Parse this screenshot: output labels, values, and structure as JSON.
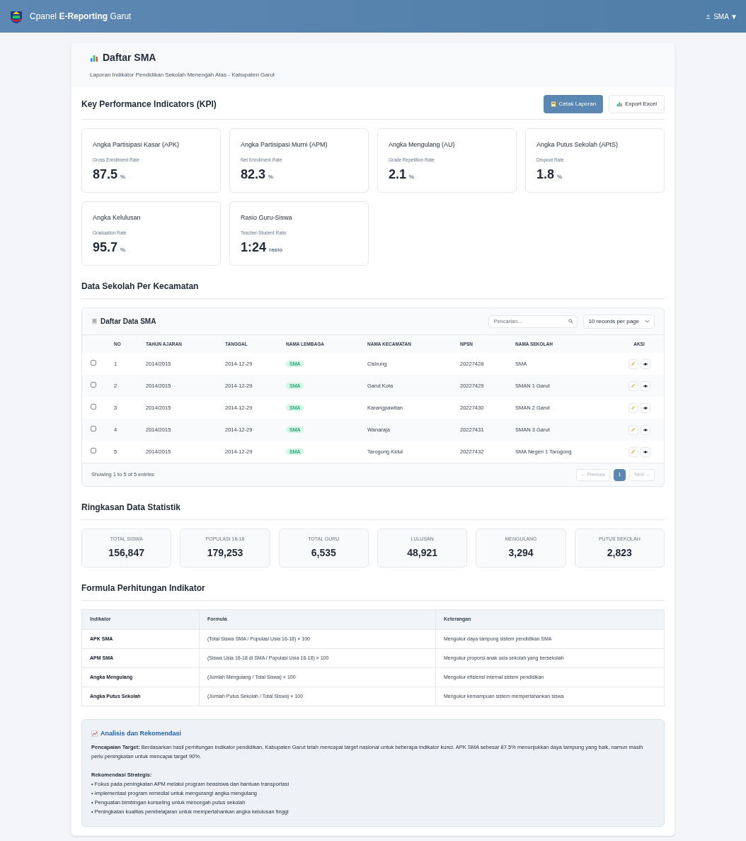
{
  "navbar": {
    "brand_prefix": "Cpanel ",
    "brand_bold": "E-Reporting",
    "brand_suffix": " Garut",
    "user": "SMA ▼"
  },
  "header": {
    "title": "Daftar SMA",
    "subtitle": "Laporan Indikator Pendidikan Sekolah Menengah Atas - Kabupaten Garut"
  },
  "kpi": {
    "title": "Key Performance Indicators (KPI)",
    "buttons": [
      {
        "kind": "primary",
        "label": "Cetak Laporan"
      },
      {
        "kind": "secondary",
        "label": "Export Excel"
      }
    ],
    "cards": [
      {
        "title": "Angka Partisipasi Kasar (APK)",
        "subtitle": "Gross Enrollment Rate",
        "value": "87.5",
        "unit": "%"
      },
      {
        "title": "Angka Partisipasi Murni (APM)",
        "subtitle": "Net Enrollment Rate",
        "value": "82.3",
        "unit": "%"
      },
      {
        "title": "Angka Mengulang (AU)",
        "subtitle": "Grade Repetition Rate",
        "value": "2.1",
        "unit": "%"
      },
      {
        "title": "Angka Putus Sekolah (APtS)",
        "subtitle": "Dropout Rate",
        "value": "1.8",
        "unit": "%"
      },
      {
        "title": "Angka Kelulusan",
        "subtitle": "Graduation Rate",
        "value": "95.7",
        "unit": "%"
      },
      {
        "title": "Rasio Guru-Siswa",
        "subtitle": "Teacher-Student Ratio",
        "value": "1:24",
        "unit": "rasio"
      }
    ]
  },
  "schools": {
    "section_title": "Data Sekolah Per Kecamatan",
    "panel_title": "Daftar Data SMA",
    "search": {
      "placeholder": "Pencarian..."
    },
    "page_size": "10 records per page",
    "columns": [
      "NO",
      "TAHUN AJARAN",
      "TANGGAL",
      "NAMA LEMBAGA",
      "NAMA KECAMATAN",
      "NPSN",
      "NAMA SEKOLAH",
      "AKSI"
    ],
    "rows": [
      {
        "checked": false,
        "no": "1",
        "year": "2014/2015",
        "date": "2014-12-29",
        "lembaga": "SMA",
        "kecamatan": "Cisirung",
        "npsn": "20227428",
        "sekolah": "SMA"
      },
      {
        "checked": false,
        "no": "2",
        "year": "2014/2015",
        "date": "2014-12-29",
        "lembaga": "SMA",
        "kecamatan": "Garut Kota",
        "npsn": "20227429",
        "sekolah": "SMAN 1 Garut"
      },
      {
        "checked": false,
        "no": "3",
        "year": "2014/2015",
        "date": "2014-12-29",
        "lembaga": "SMA",
        "kecamatan": "Karangpawitan",
        "npsn": "20227430",
        "sekolah": "SMAN 2 Garut"
      },
      {
        "checked": false,
        "no": "4",
        "year": "2014/2015",
        "date": "2014-12-29",
        "lembaga": "SMA",
        "kecamatan": "Wanaraja",
        "npsn": "20227431",
        "sekolah": "SMAN 3 Garut"
      },
      {
        "checked": false,
        "no": "5",
        "year": "2014/2015",
        "date": "2014-12-29",
        "lembaga": "SMA",
        "kecamatan": "Tarogong Kidul",
        "npsn": "20227432",
        "sekolah": "SMA Negeri 1 Tarogong"
      }
    ],
    "footer": "Showing 1 to 5 of 5 entries",
    "pagination": [
      {
        "label": "← Previous",
        "disabled": true,
        "selected": false
      },
      {
        "label": "1",
        "disabled": false,
        "selected": true
      },
      {
        "label": "Next →",
        "disabled": true,
        "selected": false
      }
    ]
  },
  "stats": {
    "title": "Ringkasan Data Statistik",
    "items": [
      {
        "label": "TOTAL SISWA",
        "value": "156,847"
      },
      {
        "label": "POPULASI 16-18",
        "value": "179,253"
      },
      {
        "label": "TOTAL GURU",
        "value": "6,535"
      },
      {
        "label": "LULUSAN",
        "value": "48,921"
      },
      {
        "label": "MENGULANG",
        "value": "3,294"
      },
      {
        "label": "PUTUS SEKOLAH",
        "value": "2,823"
      }
    ]
  },
  "formula": {
    "title": "Formula Perhitungan Indikator",
    "columns": [
      "Indikator",
      "Formula",
      "Keterangan"
    ],
    "rows": [
      [
        "APK SMA",
        "(Total Siswa SMA / Populasi Usia 16-18) × 100",
        "Mengukur daya tampung sistem pendidikan SMA"
      ],
      [
        "APM SMA",
        "(Siswa Usia 16-18 di SMA / Populasi Usia 16-18) × 100",
        "Mengukur proporsi anak usia sekolah yang bersekolah"
      ],
      [
        "Angka Mengulang",
        "(Jumlah Mengulang / Total Siswa) × 100",
        "Mengukur efisiensi internal sistem pendidikan"
      ],
      [
        "Angka Putus Sekolah",
        "(Jumlah Putus Sekolah / Total Siswa) × 100",
        "Mengukur kemampuan sistem mempertahankan siswa"
      ]
    ]
  },
  "analysis": {
    "title": "Analisis dan Rekomendasi",
    "paragraph": "**Pencapaian Target:** Berdasarkan hasil perhitungan indikator pendidikan, Kabupaten Garut telah mencapai target nasional untuk beberapa indikator kunci. APK SMA sebesar 87.5% menunjukkan daya tampung yang baik, namun masih perlu peningkatan untuk mencapai target 90%.",
    "recommend_title": "Rekomendasi Strategis:",
    "recommendations": [
      "• Fokus pada peningkatan APM melalui program beasiswa dan bantuan transportasi",
      "• Implementasi program remedial untuk mengurangi angka mengulang",
      "• Penguatan bimbingan konseling untuk mencegah putus sekolah",
      "• Peningkatan kualitas pembelajaran untuk mempertahankan angka kelulusan tinggi"
    ]
  }
}
